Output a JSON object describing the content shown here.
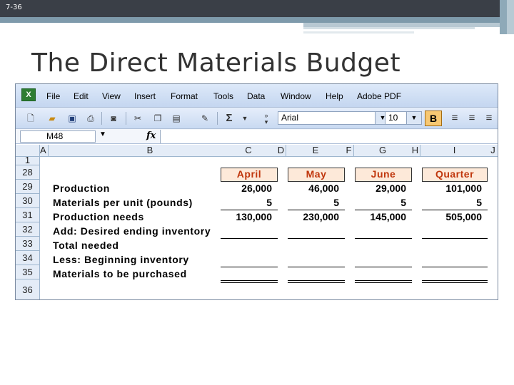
{
  "slide": {
    "number": "7-36",
    "title": "The Direct Materials Budget"
  },
  "menubar": {
    "items": [
      "File",
      "Edit",
      "View",
      "Insert",
      "Format",
      "Tools",
      "Data",
      "Window",
      "Help",
      "Adobe PDF"
    ]
  },
  "toolbar": {
    "font_name": "Arial",
    "font_size": "10",
    "bold_label": "B",
    "sum_symbol": "Σ"
  },
  "formula_bar": {
    "cell_ref": "M48",
    "fx_label": "fx"
  },
  "columns": [
    "A",
    "B",
    "C",
    "D",
    "E",
    "F",
    "G",
    "H",
    "I",
    "J"
  ],
  "rows": [
    "1",
    "28",
    "29",
    "30",
    "31",
    "32",
    "33",
    "34",
    "35",
    "36"
  ],
  "sheet": {
    "headers": [
      "April",
      "May",
      "June",
      "Quarter"
    ],
    "lines": [
      {
        "label": "Production",
        "values": [
          "26,000",
          "46,000",
          "29,000",
          "101,000"
        ]
      },
      {
        "label": "Materials per unit (pounds)",
        "values": [
          "5",
          "5",
          "5",
          "5"
        ]
      },
      {
        "label": "Production needs",
        "values": [
          "130,000",
          "230,000",
          "145,000",
          "505,000"
        ]
      },
      {
        "label": "Add: Desired ending inventory",
        "values": [
          "",
          "",
          "",
          ""
        ]
      },
      {
        "label": "Total needed",
        "values": [
          "",
          "",
          "",
          ""
        ]
      },
      {
        "label": "Less: Beginning inventory",
        "values": [
          "",
          "",
          "",
          ""
        ]
      },
      {
        "label": "Materials to be purchased",
        "values": [
          "",
          "",
          "",
          ""
        ]
      }
    ]
  },
  "colors": {
    "header_fill": "#fde9d9",
    "header_text": "#c0360c",
    "chrome_dark": "#3a3f47",
    "chrome_accent": "#7e9aab"
  }
}
